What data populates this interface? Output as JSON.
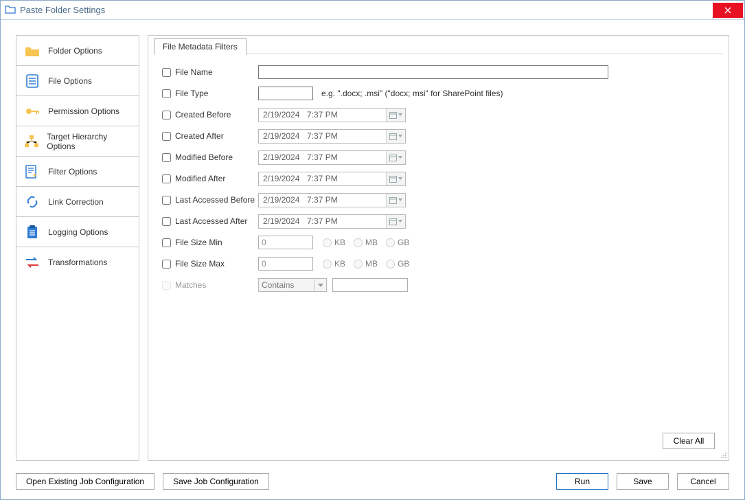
{
  "window": {
    "title": "Paste Folder Settings"
  },
  "sidebar": {
    "items": [
      {
        "label": "Folder Options"
      },
      {
        "label": "File Options"
      },
      {
        "label": "Permission Options"
      },
      {
        "label": "Target Hierarchy Options"
      },
      {
        "label": "Filter Options"
      },
      {
        "label": "Link Correction"
      },
      {
        "label": "Logging Options"
      },
      {
        "label": "Transformations"
      }
    ]
  },
  "tab": {
    "label": "File Metadata Filters"
  },
  "filters": {
    "file_name_label": "File Name",
    "file_name_value": "",
    "file_type_label": "File Type",
    "file_type_value": "",
    "file_type_hint": "e.g. \".docx; .msi\" (\"docx; msi\" for SharePoint files)",
    "created_before_label": "Created Before",
    "created_after_label": "Created After",
    "modified_before_label": "Modified Before",
    "modified_after_label": "Modified After",
    "last_accessed_before_label": "Last Accessed Before",
    "last_accessed_after_label": "Last Accessed After",
    "date_value_date": "2/19/2024",
    "date_value_time": "7:37 PM",
    "size_min_label": "File Size Min",
    "size_min_value": "0",
    "size_max_label": "File Size Max",
    "size_max_value": "0",
    "radio_kb": "KB",
    "radio_mb": "MB",
    "radio_gb": "GB",
    "matches_label": "Matches",
    "matches_mode": "Contains",
    "matches_value": ""
  },
  "buttons": {
    "clear_all": "Clear All",
    "open_config": "Open Existing Job Configuration",
    "save_config": "Save Job Configuration",
    "run": "Run",
    "save": "Save",
    "cancel": "Cancel"
  }
}
